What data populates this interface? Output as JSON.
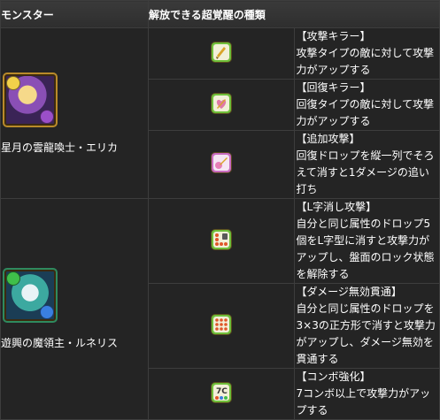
{
  "header": {
    "monster_col": "モンスター",
    "awakening_col": "解放できる超覚醒の種類"
  },
  "monsters": [
    {
      "name": "星月の雲龍喚士・エリカ",
      "avatar_icon": "erika-portrait",
      "awakenings": [
        {
          "icon": "attacker-killer-icon",
          "title": "【攻撃キラー】",
          "body": "攻撃タイプの敵に対して攻撃力がアップする"
        },
        {
          "icon": "healer-killer-icon",
          "title": "【回復キラー】",
          "body": "回復タイプの敵に対して攻撃力がアップする"
        },
        {
          "icon": "follow-up-attack-icon",
          "title": "【追加攻撃】",
          "body": "回復ドロップを縦一列でそろえて消すと1ダメージの追い打ち"
        }
      ]
    },
    {
      "name": "遊興の魔領主・ルネリス",
      "avatar_icon": "lunelis-portrait",
      "awakenings": [
        {
          "icon": "l-shape-erase-icon",
          "title": "【L字消し攻撃】",
          "body": "自分と同じ属性のドロップ5個をL字型に消すと攻撃力がアップし、盤面のロック状態を解除する"
        },
        {
          "icon": "damage-void-piercer-icon",
          "title": "【ダメージ無効貫通】",
          "body": "自分と同じ属性のドロップを3×3の正方形で消すと攻撃力がアップし、ダメージ無効を貫通する"
        },
        {
          "icon": "combo-boost-icon",
          "title": "【コンボ強化】",
          "body": "7コンボ以上で攻撃力がアップする"
        }
      ]
    }
  ],
  "colors": {
    "background": "#1e1e1e",
    "border": "#3d3d3d",
    "text": "#ffffff"
  }
}
